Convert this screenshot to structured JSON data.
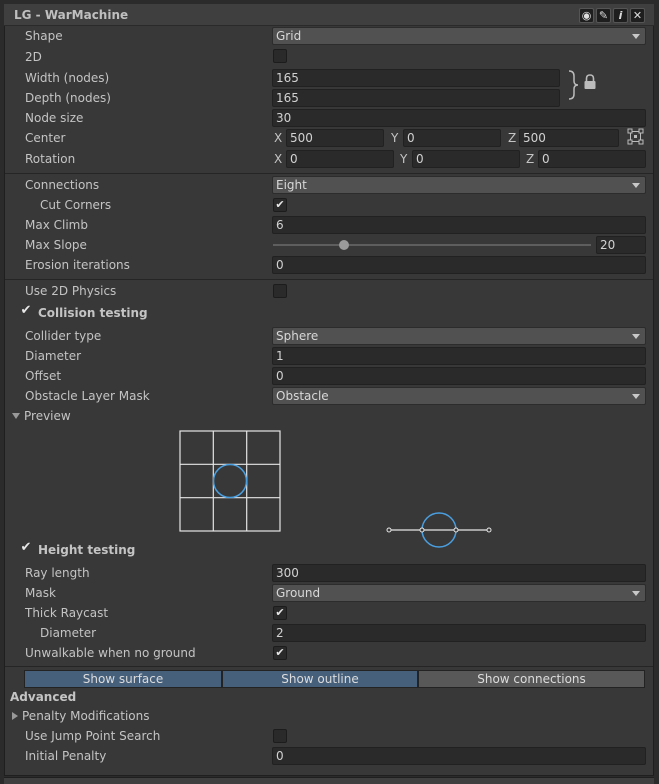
{
  "window": {
    "title": "LG - WarMachine",
    "buttons": [
      {
        "name": "eye-icon",
        "glyph": "◉"
      },
      {
        "name": "pencil-icon",
        "glyph": "✎"
      },
      {
        "name": "info-icon",
        "glyph": "i"
      },
      {
        "name": "close-icon",
        "glyph": "✕"
      }
    ]
  },
  "grid": {
    "shape_label": "Shape",
    "shape_value": "Grid",
    "twod_label": "2D",
    "width_label": "Width (nodes)",
    "width_value": "165",
    "depth_label": "Depth (nodes)",
    "depth_value": "165",
    "node_size_label": "Node size",
    "node_size_value": "30",
    "center_label": "Center",
    "center_x_axis": "X",
    "center_x": "500",
    "center_y_axis": "Y",
    "center_y": "0",
    "center_z_axis": "Z",
    "center_z": "500",
    "rotation_label": "Rotation",
    "rotation_x_axis": "X",
    "rotation_x": "0",
    "rotation_y_axis": "Y",
    "rotation_y": "0",
    "rotation_z_axis": "Z",
    "rotation_z": "0"
  },
  "connections": {
    "connections_label": "Connections",
    "connections_value": "Eight",
    "cut_corners_label": "Cut Corners",
    "cut_corners_checked": true,
    "max_climb_label": "Max Climb",
    "max_climb_value": "6",
    "max_slope_label": "Max Slope",
    "max_slope_value": "20",
    "max_slope_fraction": 0.2222,
    "erosion_label": "Erosion iterations",
    "erosion_value": "0"
  },
  "collision": {
    "use_2d_physics_label": "Use 2D Physics",
    "collision_testing_label": "Collision testing",
    "collision_testing_checked": true,
    "collider_type_label": "Collider type",
    "collider_type_value": "Sphere",
    "diameter_label": "Diameter",
    "diameter_value": "1",
    "offset_label": "Offset",
    "offset_value": "0",
    "obstacle_mask_label": "Obstacle Layer Mask",
    "obstacle_mask_value": "Obstacle",
    "preview_label": "Preview"
  },
  "height": {
    "height_testing_label": "Height testing",
    "height_testing_checked": true,
    "ray_length_label": "Ray length",
    "ray_length_value": "300",
    "mask_label": "Mask",
    "mask_value": "Ground",
    "thick_raycast_label": "Thick Raycast",
    "thick_raycast_checked": true,
    "diameter_label": "Diameter",
    "diameter_value": "2",
    "unwalkable_label": "Unwalkable when no ground",
    "unwalkable_checked": true
  },
  "toggles": {
    "show_surface": "Show surface",
    "show_outline": "Show outline",
    "show_connections": "Show connections"
  },
  "advanced": {
    "header": "Advanced",
    "penalty_label": "Penalty Modifications",
    "jump_point_label": "Use Jump Point Search",
    "initial_penalty_label": "Initial Penalty",
    "initial_penalty_value": "0"
  },
  "colors": {
    "panel_bg": "#383838",
    "field_bg": "#2a2a2a",
    "dropdown_bg": "#515151",
    "toggle_on": "#46607c",
    "toggle_off": "#585858",
    "preview_circle": "#4a9fe0"
  }
}
